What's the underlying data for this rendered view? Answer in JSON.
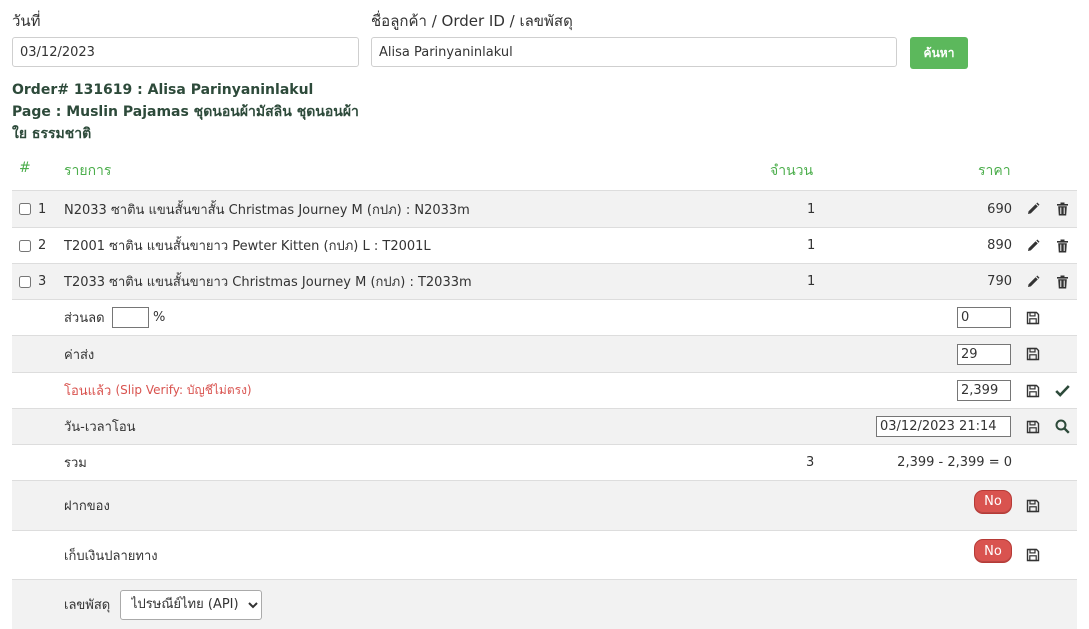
{
  "search": {
    "date_label": "วันที่",
    "date_value": "03/12/2023",
    "customer_label": "ชื่อลูกค้า / Order ID / เลขพัสดุ",
    "customer_value": "Alisa Parinyaninlakul",
    "search_button": "ค้นหา"
  },
  "order": {
    "title": "Order# 131619 : Alisa Parinyaninlakul",
    "page": "Page : Muslin Pajamas ชุดนอนผ้ามัสลิน ชุดนอนผ้าใย ธรรมชาติ"
  },
  "table": {
    "headers": {
      "index": "#",
      "item": "รายการ",
      "qty": "จำนวน",
      "price": "ราคา"
    },
    "items": [
      {
        "index": "1",
        "name": "N2033 ซาติน แขนสั้นขาสั้น Christmas Journey M (กปภ) : N2033m",
        "qty": "1",
        "price": "690"
      },
      {
        "index": "2",
        "name": "T2001 ซาติน แขนสั้นขายาว Pewter Kitten (กปภ) L : T2001L",
        "qty": "1",
        "price": "890"
      },
      {
        "index": "3",
        "name": "T2033 ซาติน แขนสั้นขายาว Christmas Journey M (กปภ) : T2033m",
        "qty": "1",
        "price": "790"
      }
    ]
  },
  "summary": {
    "discount_label": "ส่วนลด",
    "discount_percent_value": "",
    "percent_sign": "%",
    "discount_value": "0",
    "shipping_label": "ค่าส่ง",
    "shipping_value": "29",
    "transfer_label": "โอนแล้ว",
    "transfer_note": "(Slip Verify: บัญชีไม่ตรง)",
    "transfer_value": "2,399",
    "transfer_time_label": "วัน-เวลาโอน",
    "transfer_time_value": "03/12/2023 21:14",
    "total_label": "รวม",
    "total_qty": "3",
    "total_value": "2,399 - 2,399 = 0",
    "deposit_label": "ฝากของ",
    "deposit_toggle": "No",
    "cod_label": "เก็บเงินปลายทาง",
    "cod_toggle": "No",
    "tracking_label": "เลขพัสดุ",
    "carrier_selected": "ไปรษณีย์ไทย (API)"
  },
  "colors": {
    "accent_green": "#5cb85c",
    "header_green": "#4cae4c",
    "danger_red": "#d9534f",
    "row_shade": "#f2f2f2"
  },
  "icons": {
    "edit": "pencil-icon",
    "delete": "trash-icon",
    "save": "floppy-icon",
    "verify": "check-icon",
    "lookup": "search-icon"
  }
}
